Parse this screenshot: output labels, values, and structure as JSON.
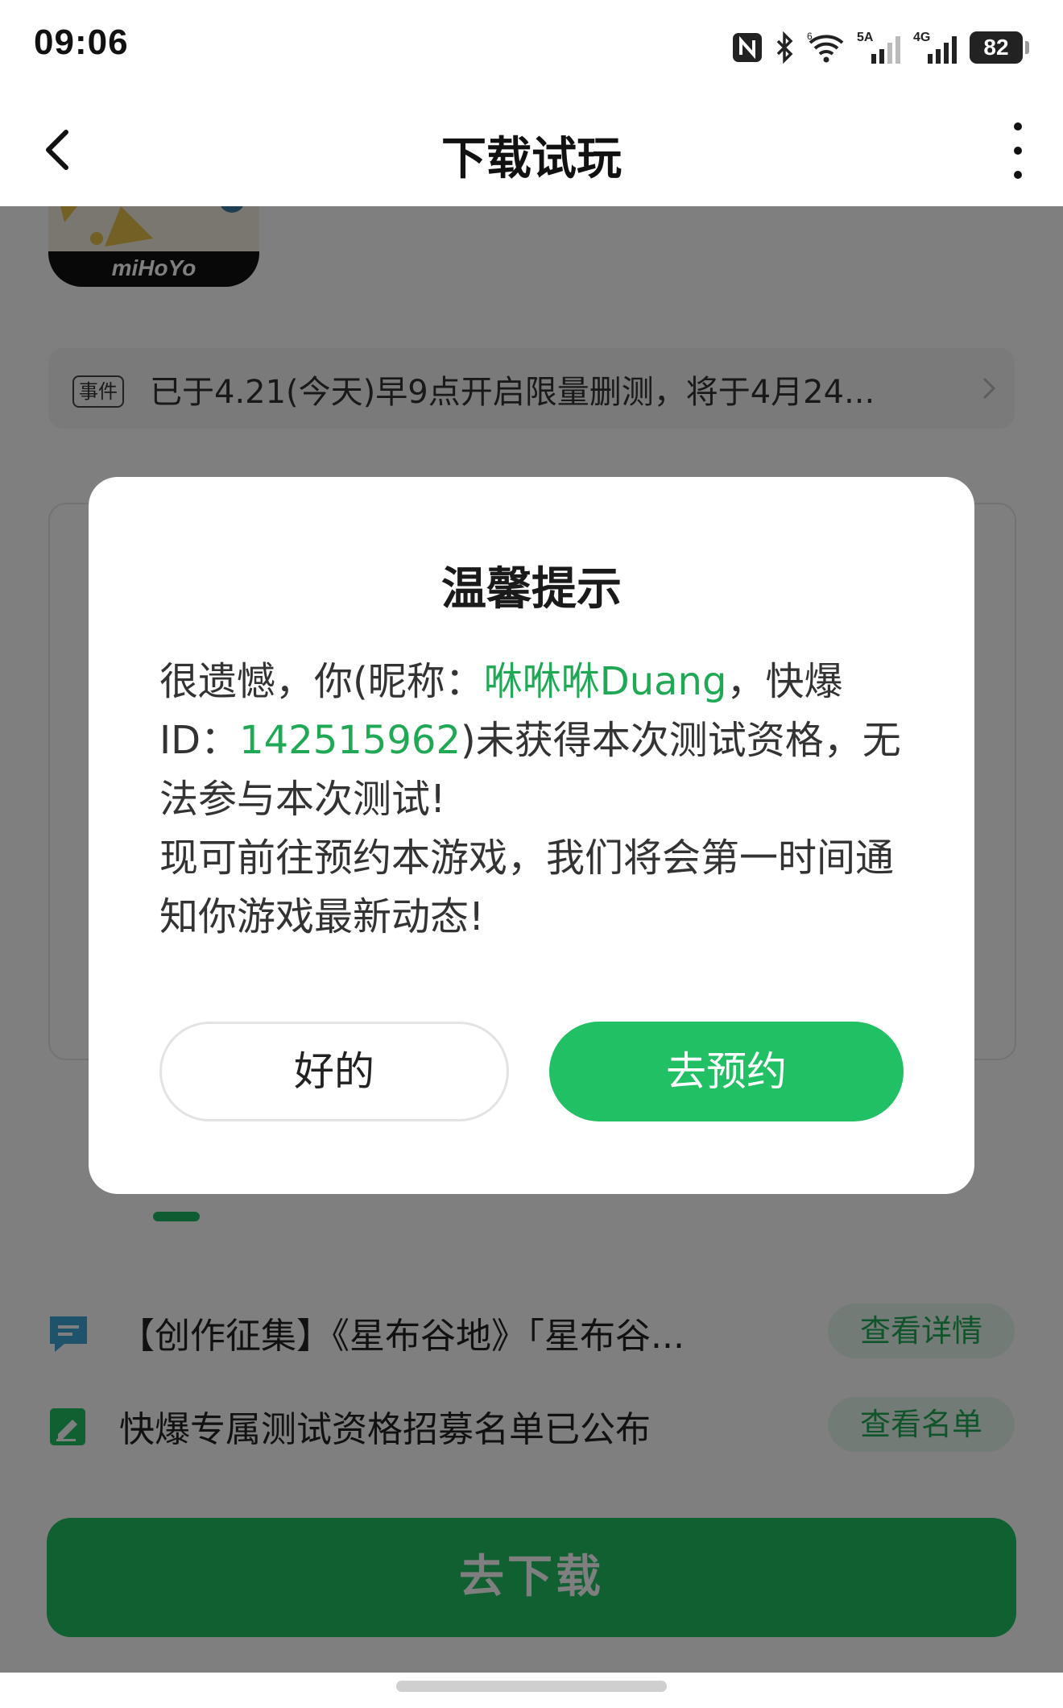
{
  "status_bar": {
    "time": "09:06",
    "signal_label_1": "5A",
    "signal_label_2": "4G",
    "battery": "82"
  },
  "navbar": {
    "title": "下载试玩"
  },
  "app": {
    "logo_text": "miHoYo"
  },
  "event": {
    "tag": "事件",
    "text": "已于4.21(今天)早9点开启限量删测，将于4月24..."
  },
  "rows": [
    {
      "text": "【创作征集】《星布谷地》「星布谷...",
      "button": "查看详情"
    },
    {
      "text": "快爆专属测试资格招募名单已公布",
      "button": "查看名单"
    }
  ],
  "download_button": "去下载",
  "dialog": {
    "title": "温馨提示",
    "body_prefix": "很遗憾，你(昵称：",
    "nickname": "咻咻咻Duang",
    "body_mid": "，快爆ID：",
    "user_id": "142515962",
    "body_suffix": ")未获得本次测试资格，无法参与本次测试!",
    "body_line2": "现可前往预约本游戏，我们将会第一时间通知你游戏最新动态!",
    "ok_button": "好的",
    "reserve_button": "去预约"
  },
  "colors": {
    "accent_green": "#22c064",
    "highlight_green": "#1fa955"
  }
}
